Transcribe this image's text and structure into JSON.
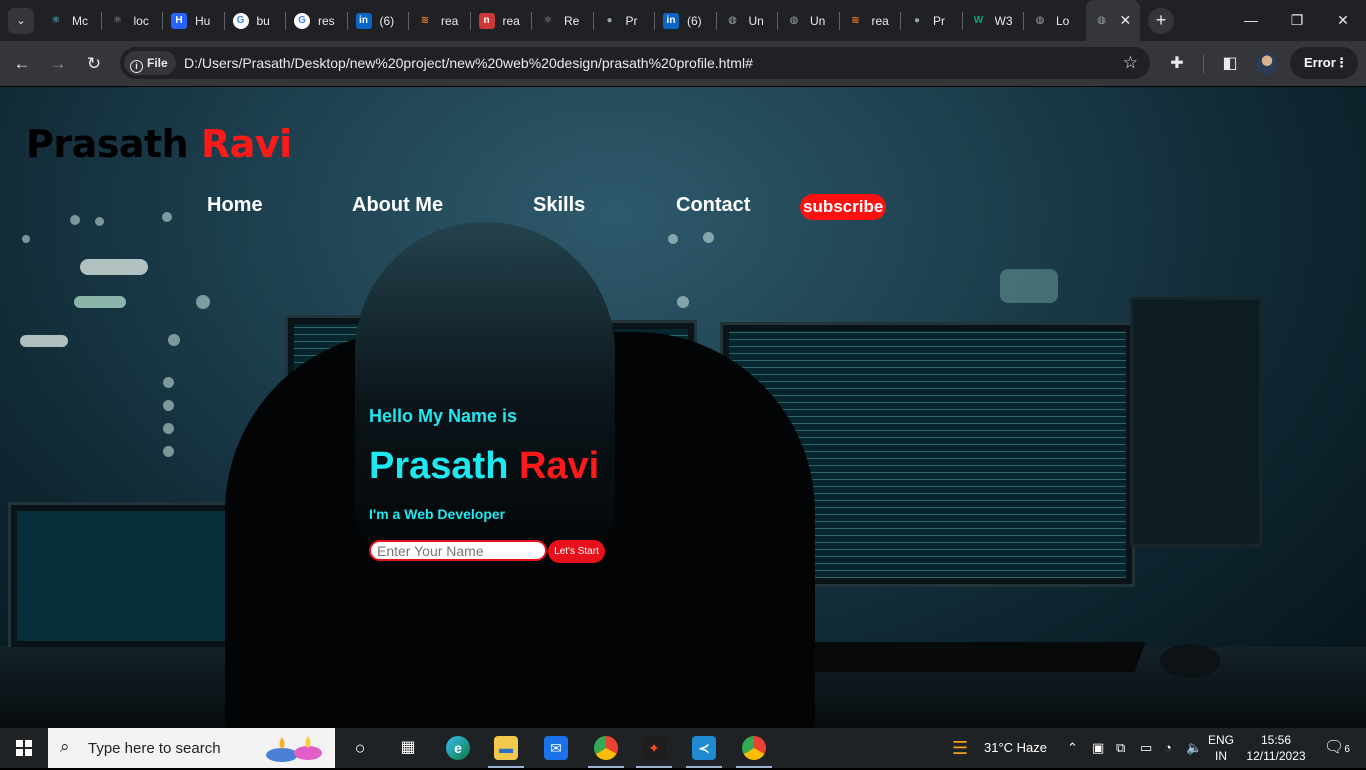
{
  "browser": {
    "tabs": [
      {
        "icon": "react-icon",
        "title": "Mc",
        "color": "#61dafb"
      },
      {
        "icon": "react-icon",
        "title": "loc",
        "color": "#8a8d91"
      },
      {
        "icon": "hashnode-icon",
        "title": "Hu",
        "color": "#2962ff"
      },
      {
        "icon": "google-icon",
        "title": "bu",
        "color": "#ffffff"
      },
      {
        "icon": "google-icon",
        "title": "res",
        "color": "#ffffff"
      },
      {
        "icon": "linkedin-icon",
        "title": "(6)",
        "color": "#0a66c2"
      },
      {
        "icon": "stackoverflow-icon",
        "title": "rea",
        "color": "#f48024"
      },
      {
        "icon": "npm-icon",
        "title": "rea",
        "color": "#cb3837"
      },
      {
        "icon": "react-icon",
        "title": "Re",
        "color": "#61dafb"
      },
      {
        "icon": "github-icon",
        "title": "Pr",
        "color": "#8a8d91"
      },
      {
        "icon": "linkedin-icon",
        "title": "(6)",
        "color": "#0a66c2"
      },
      {
        "icon": "globe-icon",
        "title": "Un",
        "color": "#8a8d91"
      },
      {
        "icon": "globe-icon",
        "title": "Un",
        "color": "#8a8d91"
      },
      {
        "icon": "stackoverflow-icon",
        "title": "rea",
        "color": "#f48024"
      },
      {
        "icon": "github-icon",
        "title": "Pr",
        "color": "#8a8d91"
      },
      {
        "icon": "w3schools-icon",
        "title": "W3",
        "color": "#04aa6d"
      },
      {
        "icon": "globe-icon",
        "title": "Lo",
        "color": "#8a8d91"
      }
    ],
    "active_tab_close": "✕",
    "url_scheme_label": "File",
    "url": "D:/Users/Prasath/Desktop/new%20project/new%20web%20design/prasath%20profile.html#",
    "error_label": "Error"
  },
  "site": {
    "logo_first": "Prasath",
    "logo_last": "Ravi",
    "nav": [
      "Home",
      "About Me",
      "Skills",
      "Contact"
    ],
    "subscribe": "subscribe",
    "hello": "Hello My Name is",
    "name_first": "Prasath",
    "name_last": "Ravi",
    "role": "I'm a Web Developer",
    "input_placeholder": "Enter Your Name",
    "start_button": "Let's Start",
    "colors": {
      "accent_cyan": "#1fe8f0",
      "accent_red": "#ff1a1a"
    }
  },
  "taskbar": {
    "search_placeholder": "Type here to search",
    "apps": [
      "task-view",
      "edge",
      "file-explorer",
      "mail",
      "chrome",
      "figma",
      "vscode",
      "chrome"
    ],
    "weather": "31°C  Haze",
    "lang_line1": "ENG",
    "lang_line2": "IN",
    "time": "15:56",
    "date": "12/11/2023",
    "notifications": "6"
  }
}
